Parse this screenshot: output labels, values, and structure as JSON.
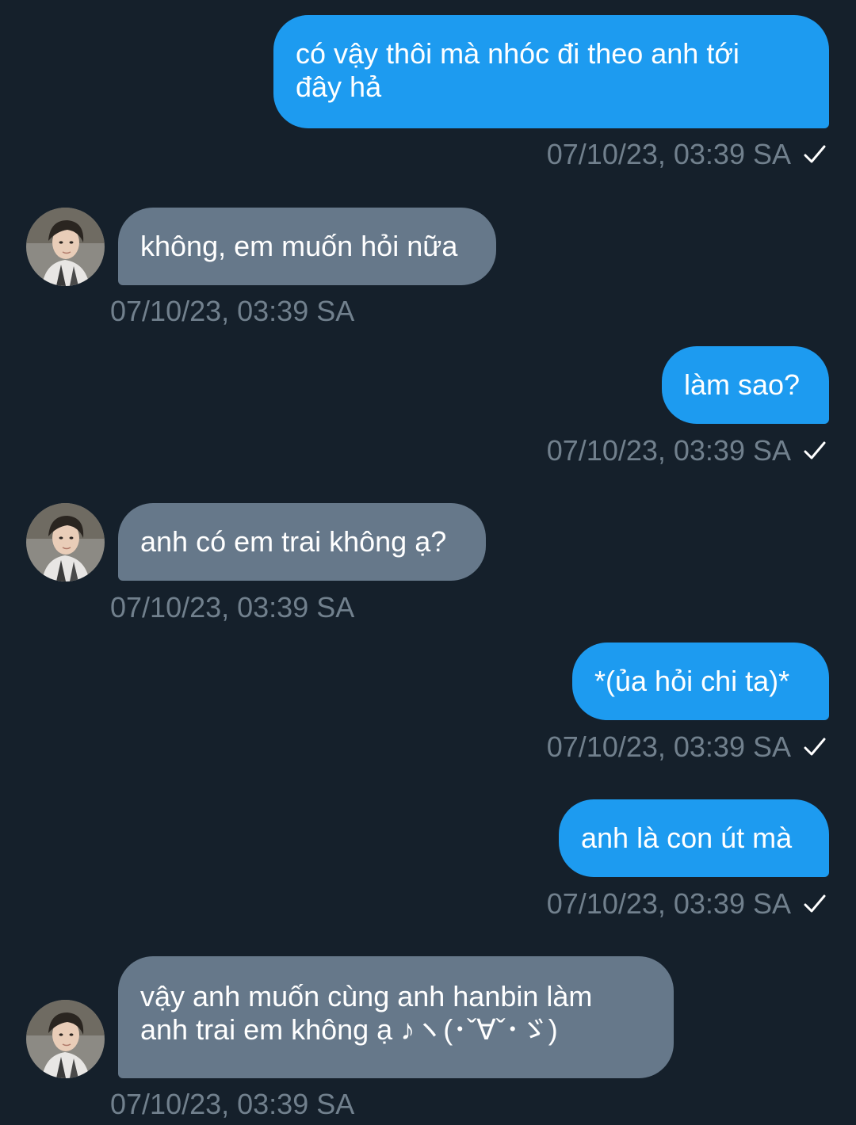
{
  "colors": {
    "background": "#15202b",
    "outgoing_bubble": "#1d9bf0",
    "incoming_bubble": "#66788a",
    "timestamp": "#71808d"
  },
  "messages": [
    {
      "direction": "outgoing",
      "text": "có vậy thôi mà nhóc đi theo anh tới\nđây hả",
      "time": "07/10/23, 03:39 SA",
      "status_icon": "check-icon"
    },
    {
      "direction": "incoming",
      "text": "không, em muốn hỏi nữa",
      "time": "07/10/23, 03:39 SA",
      "avatar_icon": "avatar"
    },
    {
      "direction": "outgoing",
      "text": "làm sao?",
      "time": "07/10/23, 03:39 SA",
      "status_icon": "check-icon"
    },
    {
      "direction": "incoming",
      "text": "anh có em trai không ạ?",
      "time": "07/10/23, 03:39 SA",
      "avatar_icon": "avatar"
    },
    {
      "direction": "outgoing",
      "text": "*(ủa hỏi chi ta)*",
      "time": "07/10/23, 03:39 SA",
      "status_icon": "check-icon"
    },
    {
      "direction": "outgoing",
      "text": "anh là con út mà",
      "time": "07/10/23, 03:39 SA",
      "status_icon": "check-icon"
    },
    {
      "direction": "incoming",
      "text": "vậy anh muốn cùng anh hanbin làm\nanh trai em không ạ ♪ヽ(･ˇ∀ˇ･ゞ)",
      "time": "07/10/23, 03:39 SA",
      "avatar_icon": "avatar"
    }
  ]
}
